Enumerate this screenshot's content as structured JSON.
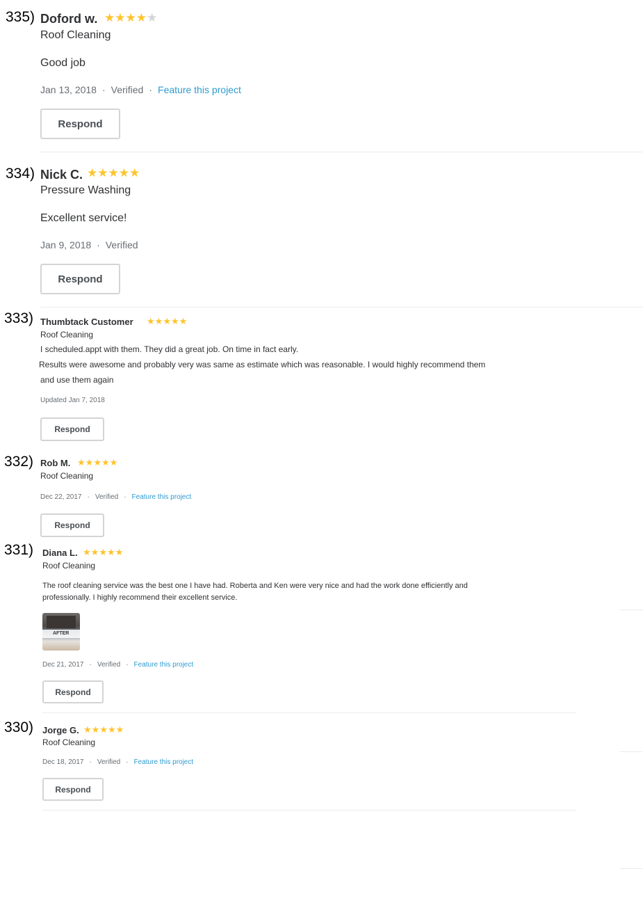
{
  "reviews": [
    {
      "number": "335)",
      "name": "Doford w.",
      "stars": "★★★★★",
      "rating": 4,
      "service": "Roof Cleaning",
      "text": "Good job",
      "date": "Jan 13, 2018",
      "verified": "Verified",
      "feature_link": "Feature this project",
      "respond_label": "Respond"
    },
    {
      "number": "334)",
      "name": "Nick C.",
      "stars": "★★★★★",
      "rating": 5,
      "service": "Pressure Washing",
      "text": "Excellent service!",
      "date": "Jan 9, 2018",
      "verified": "Verified",
      "respond_label": "Respond"
    },
    {
      "number": "333)",
      "name": "Thumbtack Customer",
      "stars": "★★★★★",
      "rating": 5,
      "service": "Roof Cleaning",
      "text_lines": [
        "I scheduled.appt with them. They did a great job. On time in fact early.",
        "Results were awesome and probably very was same as estimate which was reasonable. I would highly recommend them",
        "and use them again"
      ],
      "date": "Updated Jan 7, 2018",
      "respond_label": "Respond"
    },
    {
      "number": "332)",
      "name": "Rob M.",
      "stars": "★★★★★",
      "rating": 5,
      "service": "Roof Cleaning",
      "date": "Dec 22, 2017",
      "verified": "Verified",
      "feature_link": "Feature this project",
      "respond_label": "Respond"
    },
    {
      "number": "331)",
      "name": "Diana L.",
      "stars": "★★★★★",
      "rating": 5,
      "service": "Roof Cleaning",
      "text_lines": [
        "The roof cleaning service was the best one I have had. Roberta and Ken were very nice and had the work done efficiently and",
        "professionally. I highly recommend their excellent service."
      ],
      "photo_label": "AFTER",
      "date": "Dec 21, 2017",
      "verified": "Verified",
      "feature_link": "Feature this project",
      "respond_label": "Respond"
    },
    {
      "number": "330)",
      "name": "Jorge G.",
      "stars": "★★★★★",
      "rating": 5,
      "service": "Roof Cleaning",
      "date": "Dec 18, 2017",
      "verified": "Verified",
      "feature_link": "Feature this project",
      "respond_label": "Respond"
    }
  ],
  "colors": {
    "star": "#fec42d",
    "star_empty": "#d3d4d5",
    "link": "#2f9bd1",
    "text": "#2f3033",
    "meta": "#676d73",
    "border": "#d3d4d5"
  }
}
